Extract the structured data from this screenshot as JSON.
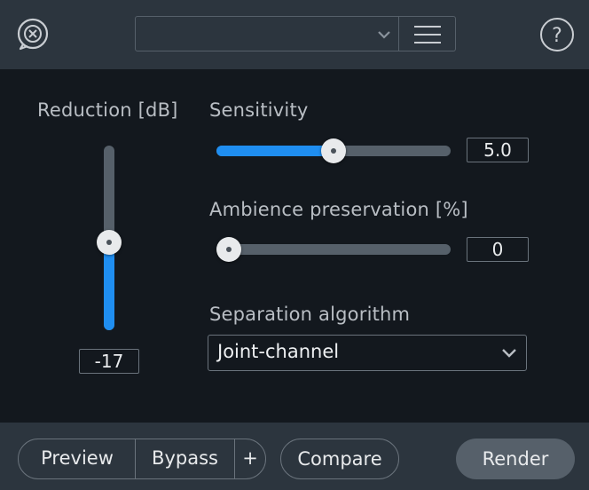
{
  "header": {
    "preset_value": "",
    "icons": {
      "logo": "audio-plugin-logo-icon",
      "preset_chevron": "chevron-down-icon",
      "menu": "hamburger-menu-icon",
      "help": "help-icon"
    }
  },
  "reduction": {
    "label": "Reduction [dB]",
    "value": "-17",
    "level_fraction": 0.47
  },
  "sensitivity": {
    "label": "Sensitivity",
    "value": "5.0",
    "level_fraction": 0.5
  },
  "ambience": {
    "label": "Ambience preservation [%]",
    "value": "0",
    "level_fraction": 0.0
  },
  "algorithm": {
    "label": "Separation algorithm",
    "selected": "Joint-channel"
  },
  "footer": {
    "preview_label": "Preview",
    "bypass_label": "Bypass",
    "plus_label": "+",
    "compare_label": "Compare",
    "render_label": "Render"
  },
  "colors": {
    "accent": "#1f8ef1",
    "bar_background": "#2c353e",
    "panel_background": "#13181e",
    "track": "#56606a"
  }
}
